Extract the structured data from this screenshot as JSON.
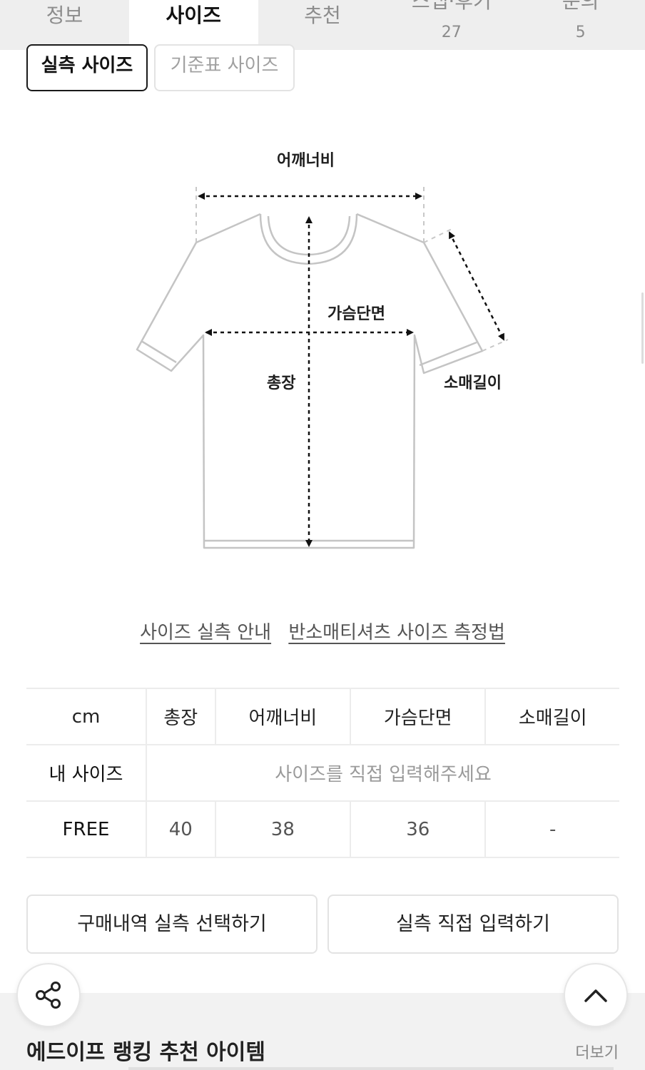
{
  "tabs": [
    {
      "label": "정보",
      "count": null
    },
    {
      "label": "사이즈",
      "count": null,
      "active": true
    },
    {
      "label": "추천",
      "count": null
    },
    {
      "label": "스냅·후기",
      "count": "27"
    },
    {
      "label": "문의",
      "count": "5"
    }
  ],
  "size_toggle": {
    "actual": "실측 사이즈",
    "standard": "기준표 사이즈"
  },
  "diagram": {
    "shoulder": "어깨너비",
    "chest": "가슴단면",
    "length": "총장",
    "sleeve": "소매길이"
  },
  "links": {
    "guide": "사이즈 실측 안내",
    "method": "반소매티셔츠 사이즈 측정법"
  },
  "table": {
    "headers": [
      "cm",
      "총장",
      "어깨너비",
      "가슴단면",
      "소매길이"
    ],
    "my_size": {
      "label": "내 사이즈",
      "placeholder": "사이즈를 직접 입력해주세요"
    },
    "rows": [
      {
        "size": "FREE",
        "values": [
          "40",
          "38",
          "36",
          "-"
        ]
      }
    ]
  },
  "buttons": {
    "history": "구매내역 실측 선택하기",
    "direct": "실측 직접 입력하기"
  },
  "recommend": {
    "title": "에드이프 랭킹 추천 아이템",
    "more": "더보기"
  },
  "icons": {
    "share": "share-icon",
    "top": "chevron-up-icon"
  }
}
